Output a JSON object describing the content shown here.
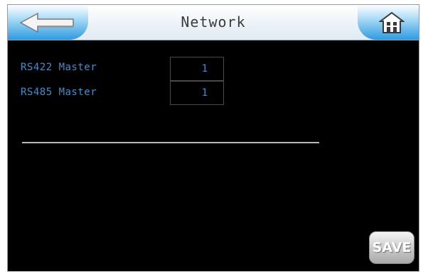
{
  "header": {
    "title": "Network",
    "back_icon": "back-arrow-icon",
    "home_icon": "home-icon"
  },
  "settings": [
    {
      "label": "RS422 Master",
      "value": "1"
    },
    {
      "label": "RS485 Master",
      "value": "1"
    }
  ],
  "footer": {
    "save_label": "SAVE"
  },
  "colors": {
    "background": "#000000",
    "label": "#3f8ecf",
    "accent": "#2f9be0"
  }
}
